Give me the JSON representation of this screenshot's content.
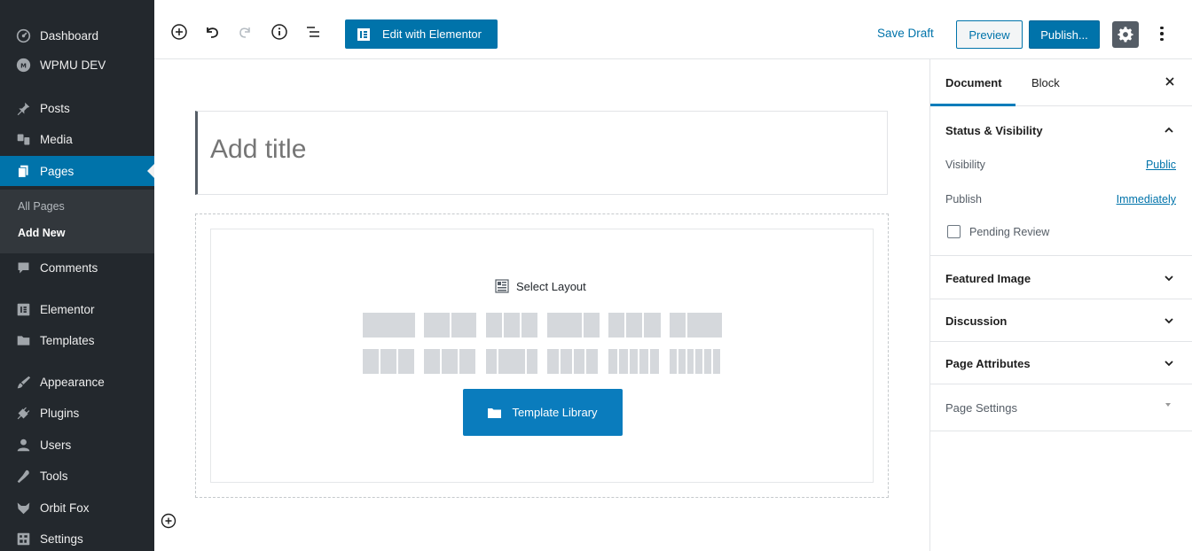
{
  "sidebar": {
    "menu": [
      {
        "label": "Dashboard",
        "icon": "dashboard-icon"
      },
      {
        "label": "WPMU DEV",
        "icon": "wpmu-dev-icon"
      },
      {
        "label": "Posts",
        "icon": "pushpin-icon"
      },
      {
        "label": "Media",
        "icon": "media-icon"
      },
      {
        "label": "Pages",
        "icon": "pages-icon",
        "active": true
      },
      {
        "label": "Comments",
        "icon": "comment-bubble-icon"
      },
      {
        "label": "Elementor",
        "icon": "elementor-icon"
      },
      {
        "label": "Templates",
        "icon": "folder-icon"
      },
      {
        "label": "Appearance",
        "icon": "paintbrush-icon"
      },
      {
        "label": "Plugins",
        "icon": "plug-icon"
      },
      {
        "label": "Users",
        "icon": "users-icon"
      },
      {
        "label": "Tools",
        "icon": "wrench-icon"
      },
      {
        "label": "Orbit Fox",
        "icon": "fox-icon"
      },
      {
        "label": "Settings",
        "icon": "settings-grid-icon"
      }
    ],
    "submenu": {
      "all_pages": "All Pages",
      "add_new": "Add New"
    }
  },
  "toolbar": {
    "edit_with_elementor": "Edit with Elementor",
    "save_draft": "Save Draft",
    "preview": "Preview",
    "publish": "Publish..."
  },
  "editor": {
    "title_placeholder": "Add title",
    "select_layout": "Select Layout",
    "template_library": "Template Library"
  },
  "panel": {
    "tabs": {
      "document": "Document",
      "block": "Block"
    },
    "status_visibility": {
      "title": "Status & Visibility",
      "visibility_label": "Visibility",
      "visibility_value": "Public",
      "publish_label": "Publish",
      "publish_value": "Immediately",
      "pending_review": "Pending Review"
    },
    "sections": {
      "featured_image": "Featured Image",
      "discussion": "Discussion",
      "page_attributes": "Page Attributes",
      "page_settings": "Page Settings"
    }
  },
  "colors": {
    "sidebar_bg": "#23282d",
    "accent": "#0073aa",
    "layout_placeholder": "#d5d8dc"
  }
}
